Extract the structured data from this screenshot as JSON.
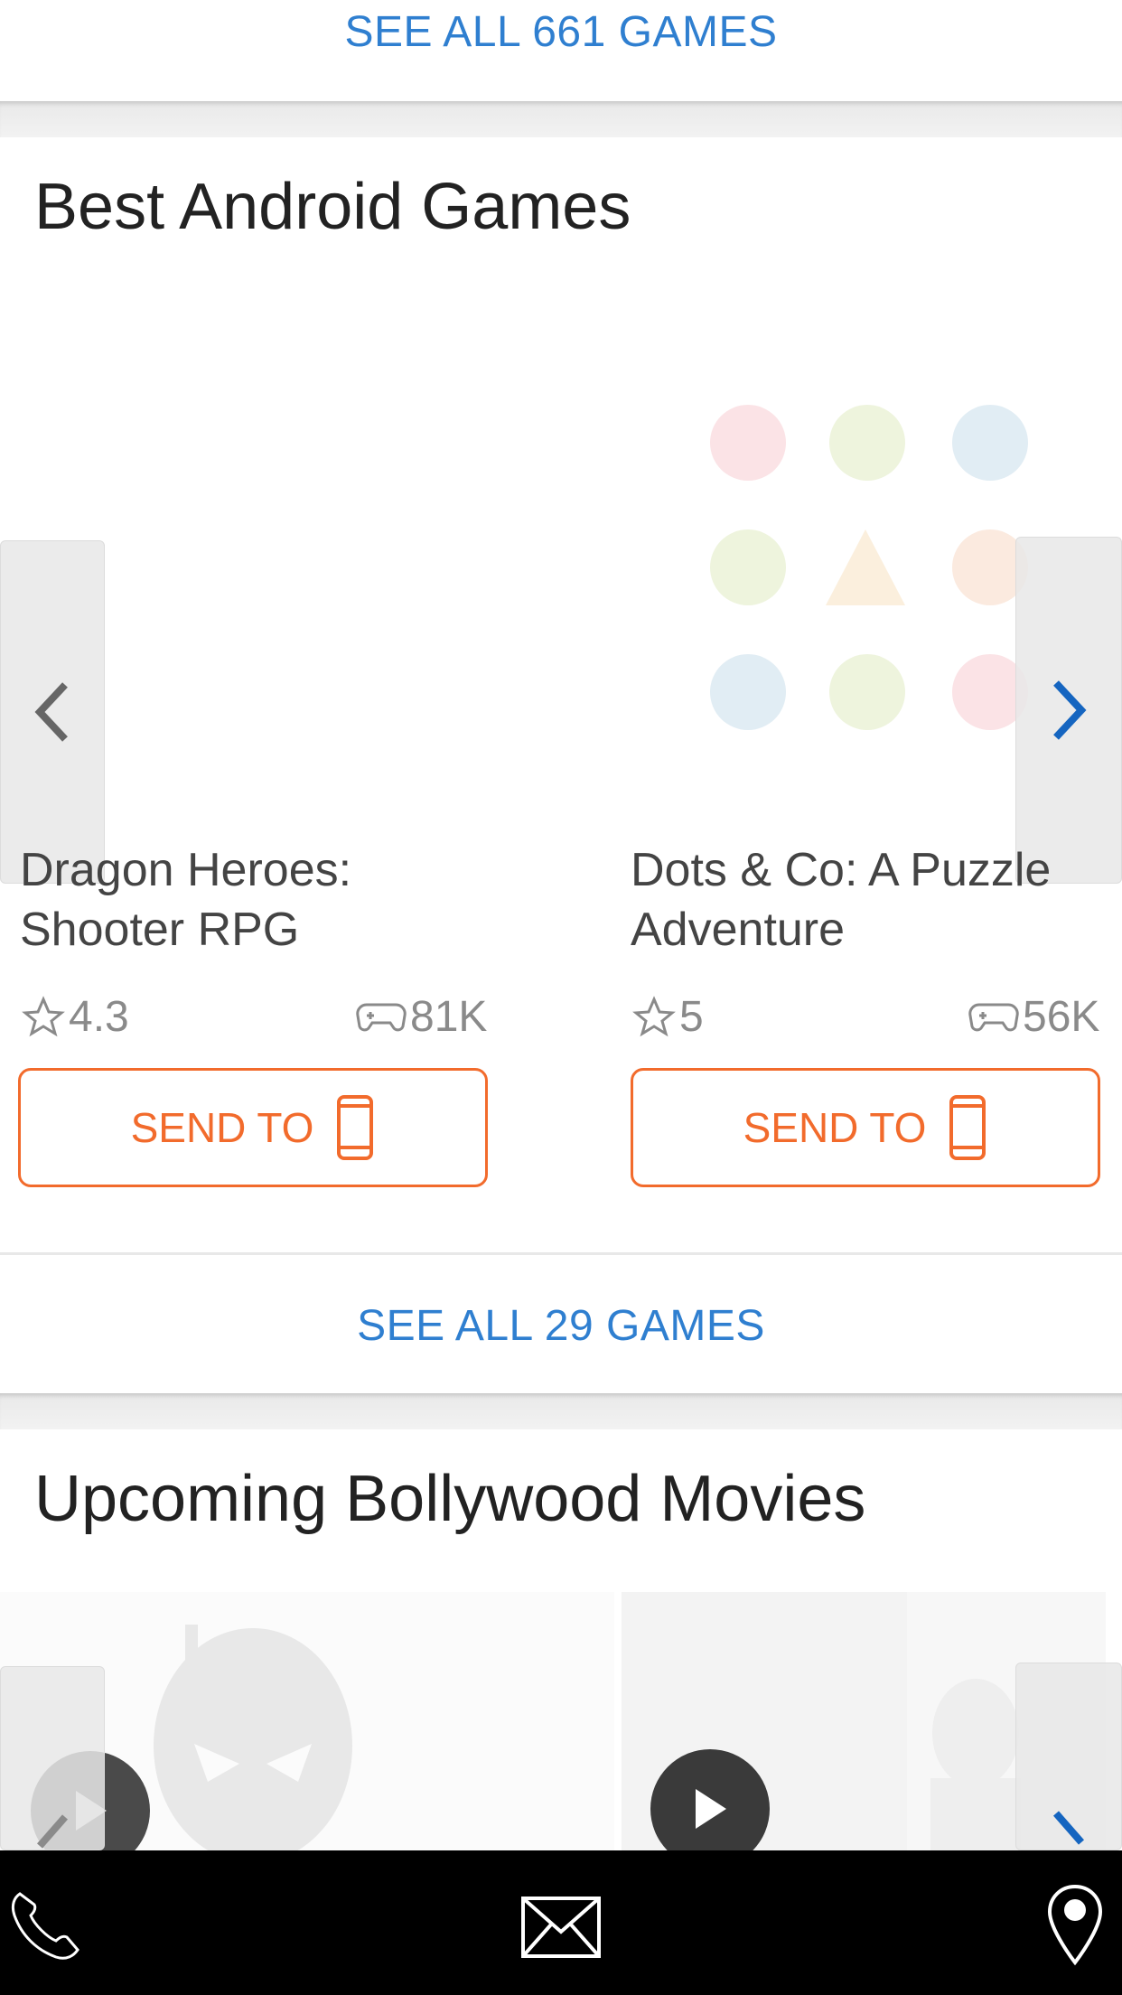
{
  "top_section": {
    "see_all_label": "SEE ALL 661 GAMES"
  },
  "android_games": {
    "title": "Best Android Games",
    "games": [
      {
        "name_line1": "Dragon Heroes:",
        "name_line2": "Shooter RPG",
        "rating": "4.3",
        "players": "81K",
        "send_label": "SEND TO"
      },
      {
        "name_line1": "Dots & Co: A Puzzle",
        "name_line2": "Adventure",
        "rating": "5",
        "players": "56K",
        "send_label": "SEND TO"
      }
    ],
    "see_all_label": "SEE ALL 29 GAMES"
  },
  "bollywood_movies": {
    "title": "Upcoming Bollywood Movies"
  },
  "bottom_bar": {
    "icons": [
      "phone-icon",
      "mail-icon",
      "location-pin-icon"
    ]
  },
  "colors": {
    "link_blue": "#2f7fd0",
    "accent_orange": "#f26b2c",
    "arrow_blue": "#1565c0"
  }
}
